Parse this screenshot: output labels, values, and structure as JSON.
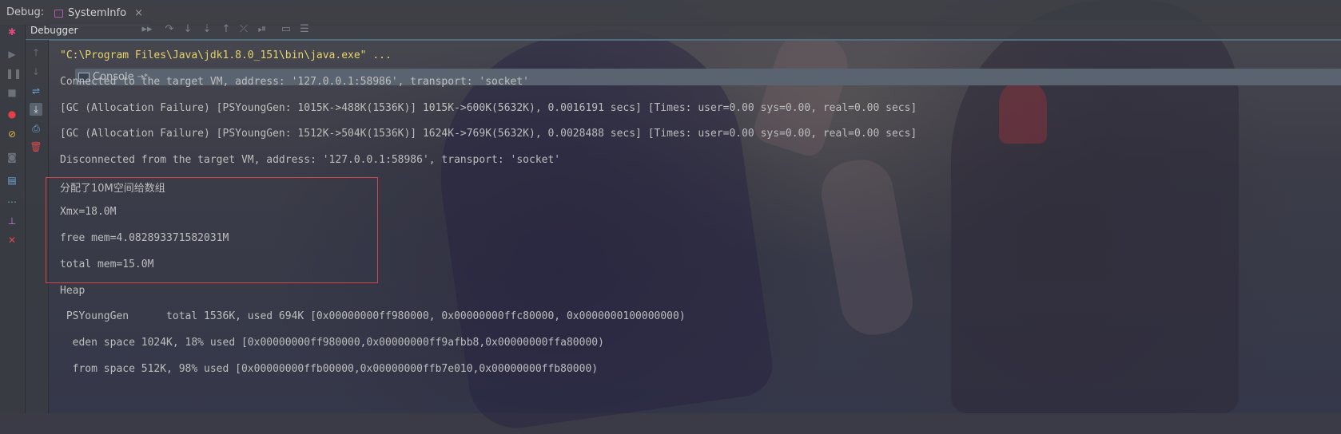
{
  "header": {
    "debug_label": "Debug:",
    "tab_label": "SystemInfo",
    "tab_close": "×"
  },
  "toolbar": {
    "debugger_label": "Debugger",
    "console_label": "Console",
    "console_pin": "→*"
  },
  "console": {
    "lines": [
      "\"C:\\Program Files\\Java\\jdk1.8.0_151\\bin\\java.exe\" ...",
      "Connected to the target VM, address: '127.0.0.1:58986', transport: 'socket'",
      "[GC (Allocation Failure) [PSYoungGen: 1015K->488K(1536K)] 1015K->600K(5632K), 0.0016191 secs] [Times: user=0.00 sys=0.00, real=0.00 secs]",
      "[GC (Allocation Failure) [PSYoungGen: 1512K->504K(1536K)] 1624K->769K(5632K), 0.0028488 secs] [Times: user=0.00 sys=0.00, real=0.00 secs]",
      "Disconnected from the target VM, address: '127.0.0.1:58986', transport: 'socket'",
      "分配了10M空间给数组",
      "Xmx=18.0M",
      "free mem=4.082893371582031M",
      "total mem=15.0M",
      "Heap",
      " PSYoungGen      total 1536K, used 694K [0x00000000ff980000, 0x00000000ffc80000, 0x0000000100000000)",
      "  eden space 1024K, 18% used [0x00000000ff980000,0x00000000ff9afbb8,0x00000000ffa80000)",
      "  from space 512K, 98% used [0x00000000ffb00000,0x00000000ffb7e010,0x00000000ffb80000)"
    ]
  },
  "icons": {
    "debug": "bug-icon",
    "resume": "resume-icon",
    "pause": "pause-icon",
    "stop": "stop-icon",
    "breakpoints": "view-breakpoints-icon",
    "mute": "mute-breakpoints-icon",
    "camera": "camera-icon",
    "layout": "layout-icon",
    "more": "more-icon",
    "pin": "pin-icon",
    "close": "close-icon"
  },
  "colors": {
    "command_text": "#e6d46a",
    "console_text": "#bdbdbd",
    "highlight_border": "#d0454a"
  }
}
